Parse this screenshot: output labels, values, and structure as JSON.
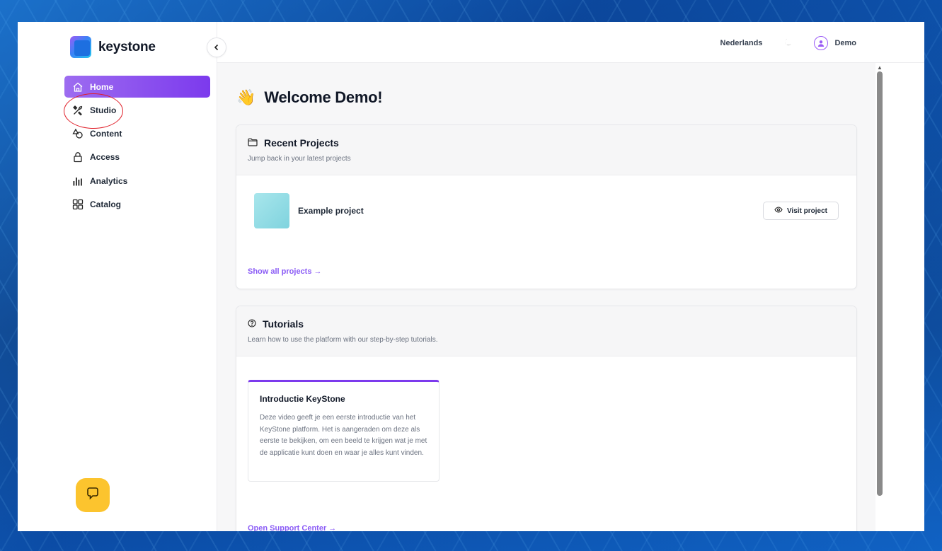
{
  "app": {
    "name": "keystone"
  },
  "sidebar": {
    "items": [
      {
        "label": "Home",
        "icon": "home-icon",
        "active": true
      },
      {
        "label": "Studio",
        "icon": "tools-icon",
        "active": false
      },
      {
        "label": "Content",
        "icon": "shapes-icon",
        "active": false
      },
      {
        "label": "Access",
        "icon": "lock-icon",
        "active": false
      },
      {
        "label": "Analytics",
        "icon": "bar-chart-icon",
        "active": false
      },
      {
        "label": "Catalog",
        "icon": "grid-icon",
        "active": false
      }
    ],
    "collapse_icon": "chevron-left-icon",
    "support_icon": "chat-bubble-icon"
  },
  "topbar": {
    "language": "Nederlands",
    "theme_icon": "moon-icon",
    "user_name": "Demo"
  },
  "main": {
    "welcome": "Welcome Demo!",
    "welcome_emoji": "👋",
    "recent_projects": {
      "title": "Recent Projects",
      "subtitle": "Jump back in your latest projects",
      "project_name": "Example project",
      "visit_label": "Visit project",
      "show_all": "Show all projects →"
    },
    "tutorials": {
      "title": "Tutorials",
      "subtitle": "Learn how to use the platform with our step-by-step tutorials.",
      "card_title": "Introductie KeyStone",
      "card_desc": "Deze video geeft je een eerste introductie van het KeyStone platform. Het is aangeraden om deze als eerste te bekijken, om een beeld te krijgen wat je met de applicatie kunt doen en waar je alles kunt vinden.",
      "support_link": "Open Support Center →"
    }
  },
  "colors": {
    "accent": "#7c3aed",
    "annotation": "#e0202a",
    "support_button": "#fcc42e"
  }
}
